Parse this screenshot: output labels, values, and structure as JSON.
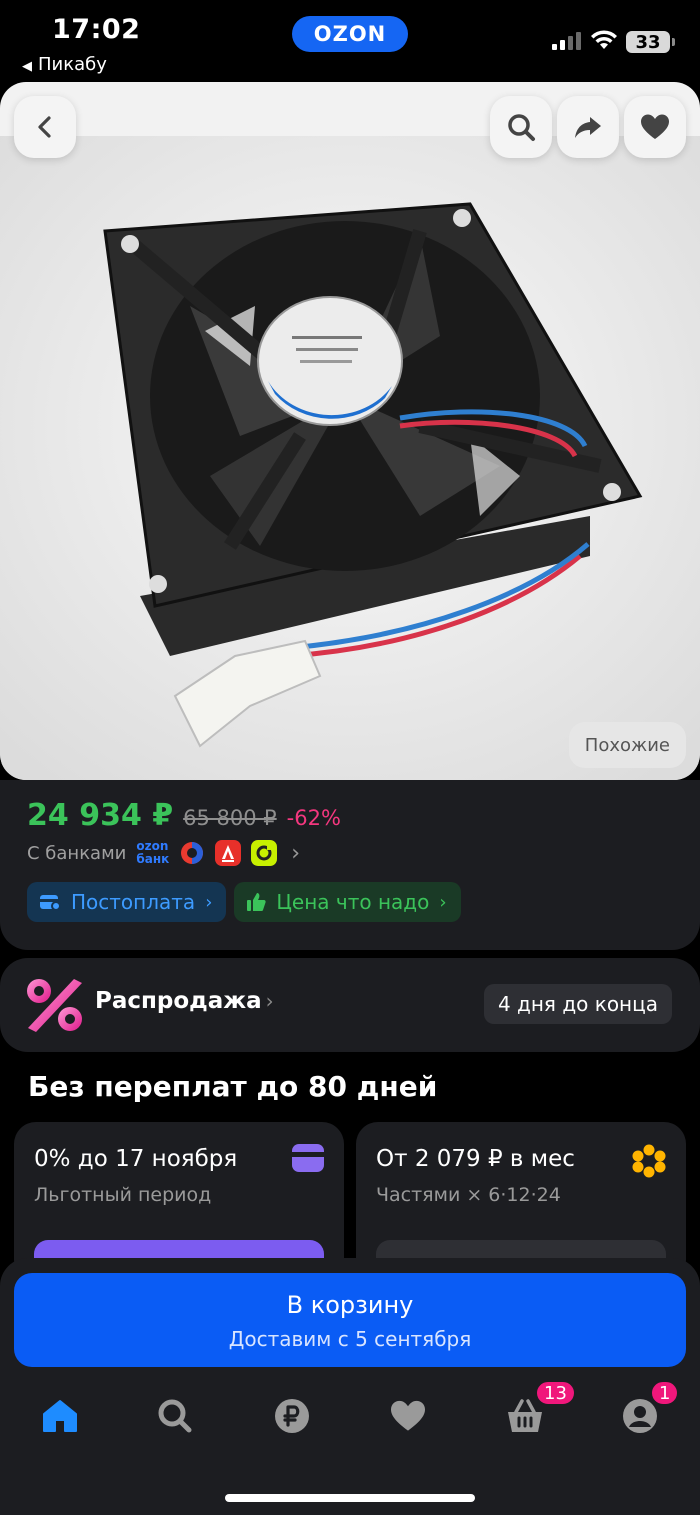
{
  "status_bar": {
    "time": "17:02",
    "back_app": "Пикабу",
    "brand": "OZON",
    "battery": "33"
  },
  "product": {
    "similar_label": "Похожие",
    "price": "24 934 ₽",
    "old_price": "65 800 ₽",
    "discount": "-62%",
    "banks_label": "С банками",
    "ozon_bank_l1": "ozon",
    "ozon_bank_l2": "банк",
    "chips": [
      {
        "label": "Постоплата"
      },
      {
        "label": "Цена что надо"
      }
    ]
  },
  "sale": {
    "title": "Распродажа",
    "days_left": "4 дня до конца"
  },
  "installment": {
    "title": "Без переплат до 80 дней",
    "cards": [
      {
        "title": "0% до 17 ноября",
        "subtitle": "Льготный период"
      },
      {
        "title": "От 2 079 ₽ в мес",
        "subtitle": "Частями × 6·12·24"
      }
    ]
  },
  "cart": {
    "label": "В корзину",
    "delivery": "Доставим с 5 сентября"
  },
  "tabbar": {
    "cart_badge": "13",
    "profile_badge": "1"
  },
  "colors": {
    "accent": "#0a5cf5",
    "price_green": "#3bc35a",
    "discount_pink": "#f5377f",
    "badge_pink": "#f0177b"
  }
}
